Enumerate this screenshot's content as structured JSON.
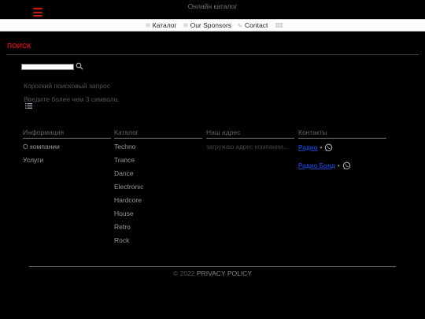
{
  "header": {
    "site_title": "Онлайн каталог"
  },
  "nav": {
    "items": [
      {
        "label": "Каталог",
        "icon": "dot-icon"
      },
      {
        "label": "Our Sponsors",
        "icon": "circle-icon"
      },
      {
        "label": "Contact",
        "icon": "phone-icon"
      }
    ],
    "mail_icon": "mail-icon"
  },
  "search": {
    "heading": "ПОИСК",
    "input_value": "",
    "hint_short": "Короткий поисковый запрос",
    "hint_min_chars": "Введите более чем 3 символа."
  },
  "footer_columns": {
    "info": {
      "title": "Информация",
      "links": [
        "О компании",
        "Услуги"
      ]
    },
    "catalog": {
      "title": "Каталог",
      "links": [
        "Techno",
        "Trance",
        "Dance",
        "Electronic",
        "Hardcore",
        "House",
        "Retro",
        "Rock"
      ]
    },
    "address": {
      "title": "Наш адрес",
      "text": "загружаю адрес компании..."
    },
    "contacts": {
      "title": "Контакты",
      "items": [
        {
          "label": "Радио",
          "sep": "•"
        },
        {
          "label": "Радио Бэнд",
          "sep": "•"
        }
      ]
    }
  },
  "footer": {
    "copyright": "© 2022",
    "privacy": "PRIVACY POLICY"
  },
  "colors": {
    "accent": "#c8161d",
    "link": "#1a3fbf",
    "background": "#000000"
  }
}
